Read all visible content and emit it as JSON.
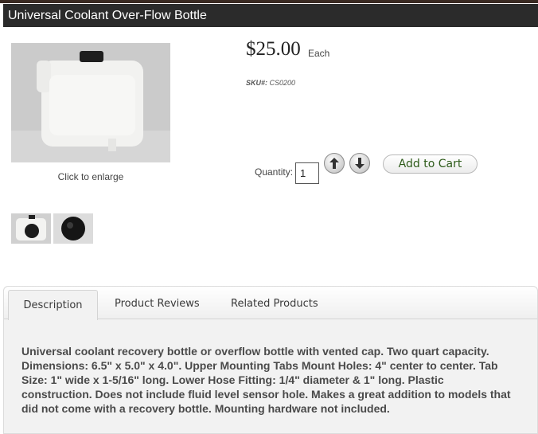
{
  "product": {
    "title": "Universal Coolant Over-Flow Bottle",
    "price": "$25.00",
    "unit": "Each",
    "sku_label": "SKU#:",
    "sku": "CS0200"
  },
  "gallery": {
    "enlarge_text": "Click to enlarge"
  },
  "cart": {
    "quantity_label": "Quantity:",
    "quantity_value": "1",
    "up_icon": "arrow-up-icon",
    "down_icon": "arrow-down-icon",
    "add_to_cart_label": "Add to Cart"
  },
  "tabs": [
    {
      "label": "Description",
      "active": true
    },
    {
      "label": "Product Reviews",
      "active": false
    },
    {
      "label": "Related Products",
      "active": false
    }
  ],
  "description": "Universal coolant recovery bottle or overflow bottle with vented cap. Two quart capacity. Dimensions: 6.5\" x 5.0\" x 4.0\". Upper Mounting Tabs Mount Holes: 4\" center to center. Tab Size: 1\" wide x 1-5/16\" long. Lower Hose Fitting: 1/4\" diameter & 1\" long. Plastic construction. Does not include fluid level sensor hole. Makes a great addition to models that did not come with a recovery bottle. Mounting hardware not included.",
  "colors": {
    "title_bar": "#2b2b2b",
    "cart_text": "#2e5b1a"
  }
}
